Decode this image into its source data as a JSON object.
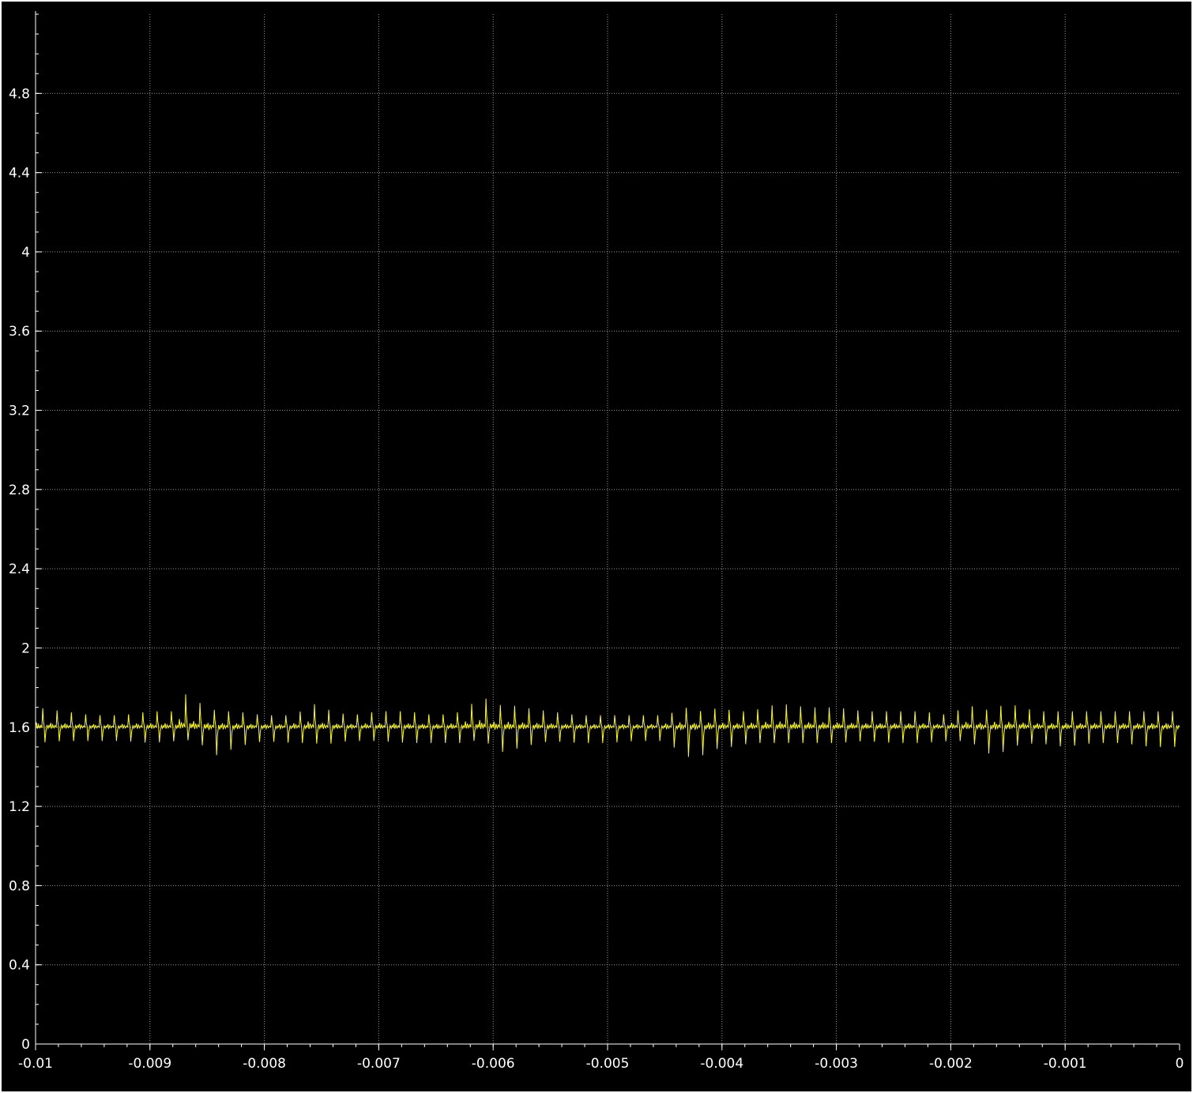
{
  "chart_data": {
    "type": "line",
    "title": "",
    "xlabel": "",
    "ylabel": "",
    "xlim": [
      -0.01,
      0
    ],
    "ylim": [
      0,
      5.2
    ],
    "x_ticks": [
      "-0.01",
      "-0.009",
      "-0.008",
      "-0.007",
      "-0.006",
      "-0.005",
      "-0.004",
      "-0.003",
      "-0.002",
      "-0.001",
      "0"
    ],
    "y_ticks": [
      "0",
      "0.4",
      "0.8",
      "1.2",
      "1.6",
      "2",
      "2.4",
      "2.8",
      "3.2",
      "3.6",
      "4",
      "4.4",
      "4.8"
    ],
    "grid": true,
    "legend": "none",
    "series": [
      {
        "color": "#ffff00",
        "baseline": 1.6,
        "period": 0.000125,
        "x": [
          -0.01,
          -0.00975,
          -0.0095,
          -0.00925,
          -0.009,
          -0.00875,
          -0.0087,
          -0.0085,
          -0.0084,
          -0.00825,
          -0.008,
          -0.00775,
          -0.00755,
          -0.0075,
          -0.0074,
          -0.00725,
          -0.007,
          -0.00675,
          -0.0065,
          -0.00625,
          -0.0061,
          -0.006,
          -0.0059,
          -0.00575,
          -0.0055,
          -0.00525,
          -0.005,
          -0.00475,
          -0.0045,
          -0.0043,
          -0.0042,
          -0.004,
          -0.0039,
          -0.00375,
          -0.0035,
          -0.00325,
          -0.003,
          -0.00275,
          -0.0025,
          -0.00225,
          -0.002,
          -0.00185,
          -0.00175,
          -0.0016,
          -0.0015,
          -0.00125,
          -0.001,
          -0.00075,
          -0.0005,
          -0.00025,
          0
        ],
        "y_peak": [
          1.7,
          1.68,
          1.66,
          1.66,
          1.68,
          1.68,
          1.77,
          1.7,
          1.68,
          1.68,
          1.66,
          1.66,
          1.72,
          1.7,
          1.68,
          1.66,
          1.68,
          1.68,
          1.66,
          1.68,
          1.77,
          1.7,
          1.72,
          1.7,
          1.68,
          1.66,
          1.66,
          1.66,
          1.66,
          1.7,
          1.68,
          1.7,
          1.68,
          1.68,
          1.72,
          1.7,
          1.7,
          1.68,
          1.68,
          1.68,
          1.66,
          1.72,
          1.68,
          1.7,
          1.72,
          1.68,
          1.68,
          1.68,
          1.68,
          1.68,
          1.68
        ],
        "y_trough": [
          1.52,
          1.53,
          1.53,
          1.53,
          1.52,
          1.53,
          1.54,
          1.5,
          1.45,
          1.5,
          1.53,
          1.52,
          1.52,
          1.5,
          1.52,
          1.53,
          1.53,
          1.52,
          1.52,
          1.52,
          1.54,
          1.5,
          1.47,
          1.5,
          1.53,
          1.52,
          1.52,
          1.53,
          1.53,
          1.45,
          1.45,
          1.5,
          1.5,
          1.52,
          1.52,
          1.52,
          1.52,
          1.53,
          1.52,
          1.52,
          1.53,
          1.53,
          1.5,
          1.44,
          1.5,
          1.52,
          1.5,
          1.52,
          1.52,
          1.5,
          1.5
        ]
      }
    ]
  }
}
